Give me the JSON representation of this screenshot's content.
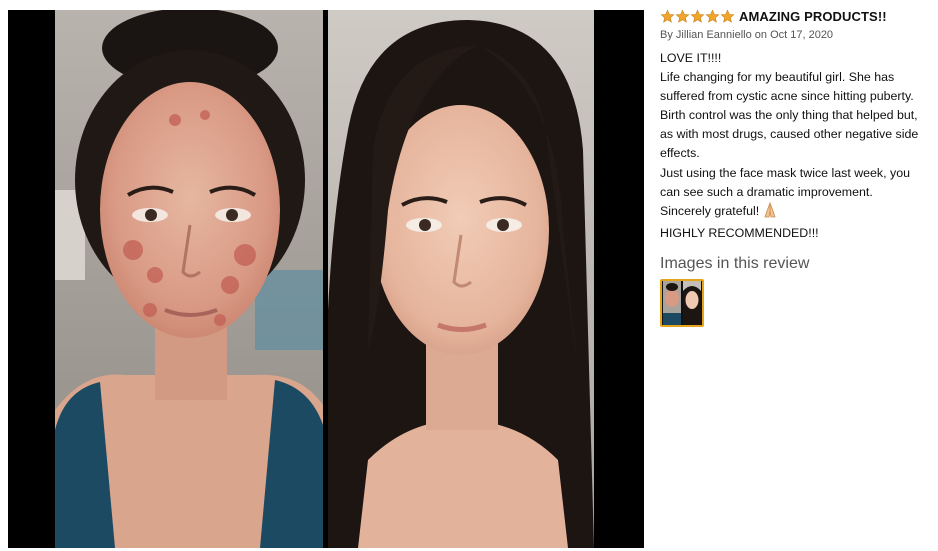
{
  "review": {
    "rating": 5,
    "max_rating": 5,
    "star_color": "#f0a52c",
    "headline": "AMAZING PRODUCTS!!",
    "byline": "By Jillian Eanniello on Oct 17, 2020",
    "body_lines": [
      "LOVE IT!!!!",
      "Life changing for my beautiful girl. She has",
      "suffered from cystic acne since hitting puberty.",
      "Birth control was the only thing that helped but,",
      "as with most drugs, caused other negative side",
      "effects.",
      "Just using the face mask twice last week, you",
      "can see such a dramatic improvement.",
      "Sincerely grateful!",
      "HIGHLY RECOMMENDED!!!"
    ],
    "grateful_emoji": "folded-hands-icon",
    "images_heading": "Images in this review",
    "thumbnail_border_color": "#e4a51c"
  },
  "photos": {
    "before": "before-photo",
    "after": "after-photo"
  }
}
